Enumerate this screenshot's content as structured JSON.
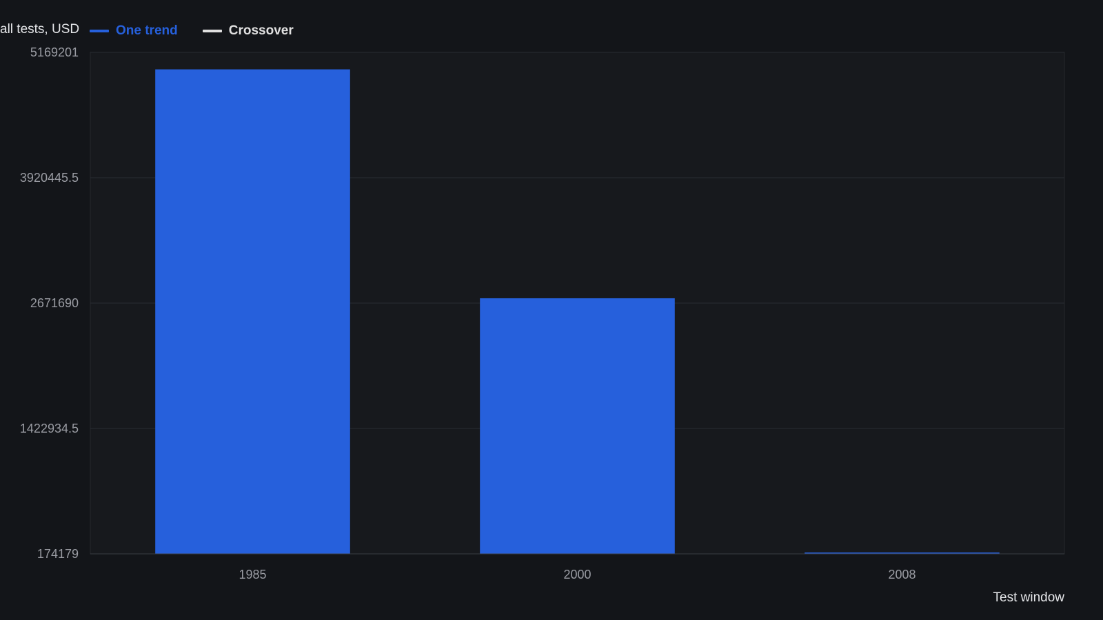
{
  "colors": {
    "background": "#131519",
    "plot_background": "#17191d",
    "grid": "#2a2d33",
    "tick_text": "#9a9ca3",
    "bar": "#2660dc",
    "legend_one_trend": "#2660dc",
    "legend_crossover": "#e0e0e0"
  },
  "chart_data": {
    "type": "bar",
    "title": "",
    "ylabel": "all tests, USD",
    "xlabel": "Test window",
    "categories": [
      "1985",
      "2000",
      "2008"
    ],
    "series": [
      {
        "name": "One trend",
        "values": [
          5000000,
          2720000,
          165000
        ]
      }
    ],
    "legend": [
      {
        "name": "One trend",
        "color": "#2660dc"
      },
      {
        "name": "Crossover",
        "color": "#e0e0e0"
      }
    ],
    "legend_position": "top-left",
    "ylim": [
      174179,
      5169201
    ],
    "yticks": [
      "174179",
      "1422934.5",
      "2671690",
      "3920445.5",
      "5169201"
    ],
    "ytick_values": [
      174179,
      1422934.5,
      2671690,
      3920445.5,
      5169201
    ],
    "grid": true
  }
}
